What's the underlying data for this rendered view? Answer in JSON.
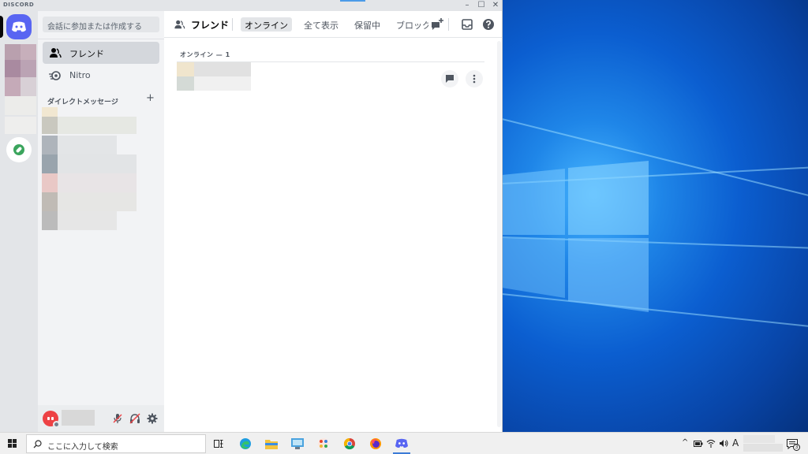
{
  "window": {
    "brand": "DISCORD",
    "minimize_glyph": "–",
    "maximize_glyph": "☐",
    "close_glyph": "✕"
  },
  "sidebar": {
    "search_placeholder": "会話に参加または作成する",
    "nav": [
      {
        "label": "フレンド",
        "icon": "friends-icon",
        "active": true
      },
      {
        "label": "Nitro",
        "icon": "nitro-icon",
        "active": false
      }
    ],
    "dm_header": "ダイレクトメッセージ",
    "dm_add_glyph": "+"
  },
  "main": {
    "title": "フレンド",
    "tabs": [
      {
        "label": "オンライン",
        "active": true
      },
      {
        "label": "全て表示",
        "active": false
      },
      {
        "label": "保留中",
        "active": false
      },
      {
        "label": "ブロック",
        "active": false
      }
    ],
    "online_heading": "オンライン — 1",
    "icons": [
      "new-group-dm-icon",
      "inbox-icon",
      "help-icon"
    ]
  },
  "user_panel": {
    "icons": [
      "mute-icon",
      "deafen-icon",
      "settings-icon"
    ]
  },
  "taskbar": {
    "search_placeholder": "ここに入力して検索",
    "apps": [
      "task-view-icon",
      "edge-icon",
      "file-explorer-icon",
      "control-panel-icon",
      "paint-icon",
      "chrome-icon",
      "firefox-icon",
      "discord-taskbar-icon"
    ],
    "ime_indicator": "A",
    "notification_count": "3"
  },
  "colors": {
    "blurple": "#5865f2",
    "online_green": "#3ba55d",
    "red": "#ed4245"
  }
}
